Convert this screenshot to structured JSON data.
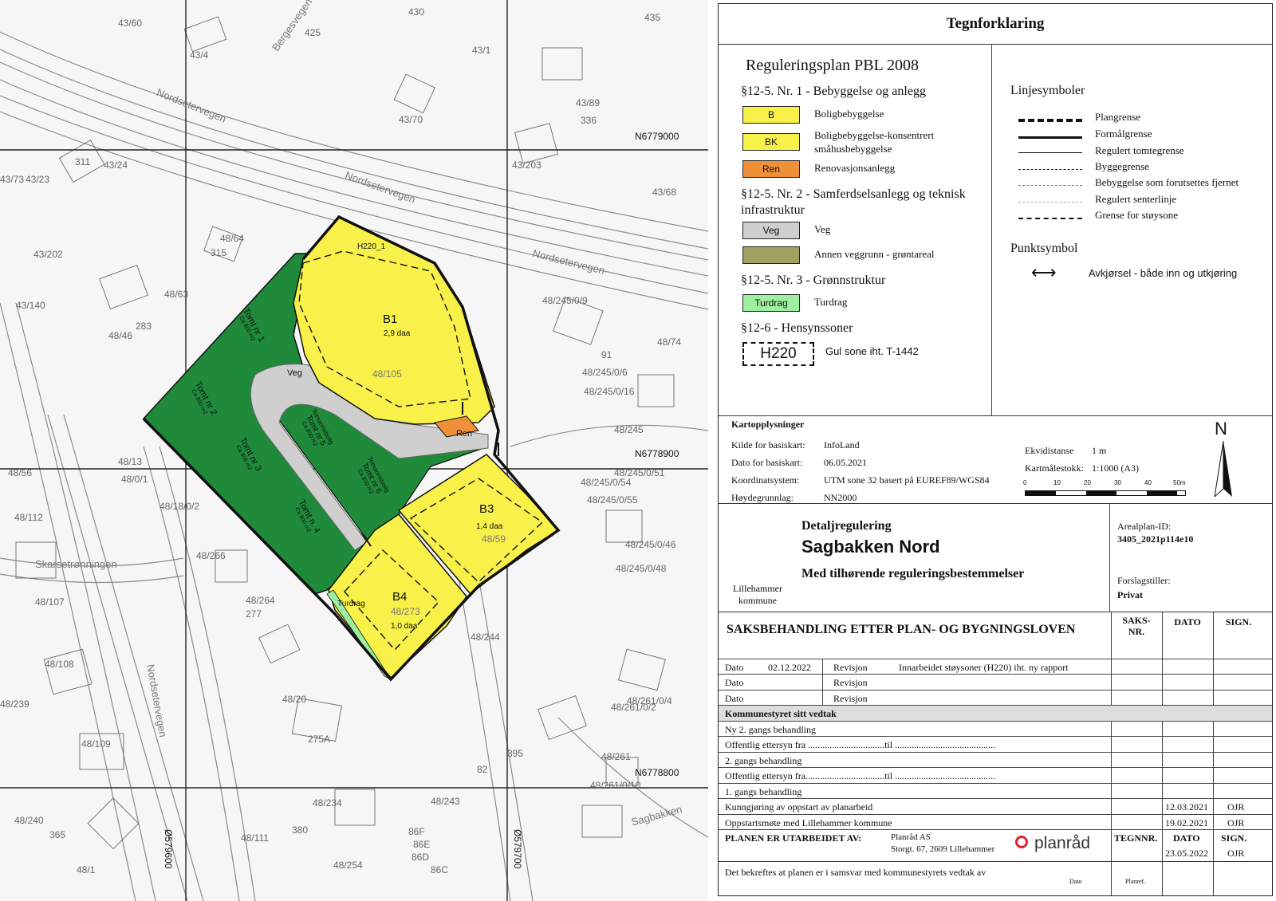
{
  "map": {
    "grid_labels": {
      "n1": "N6779000",
      "n2": "N6778900",
      "n3": "N6778800",
      "e1": "Ø579600",
      "e2": "Ø579700"
    },
    "property_labels": [
      "43/60",
      "43/4",
      "430",
      "425",
      "435",
      "43/1",
      "43/89",
      "336",
      "43/70",
      "43/23",
      "311",
      "43/24",
      "43/203",
      "43/68",
      "43/73",
      "48/64",
      "315",
      "43/202",
      "48/63",
      "43/140",
      "283",
      "48/46",
      "48/74",
      "91",
      "48/245",
      "48/245/0/9",
      "48/245/0/16",
      "48/245/0/6",
      "48/245/0/51",
      "48/245/0/54",
      "48/245/0/55",
      "48/245/0/46",
      "48/245/0/48",
      "48/56",
      "48/112",
      "48/266",
      "48/107",
      "48/264",
      "277",
      "48/244",
      "48/108",
      "48/109",
      "48/239",
      "48/20",
      "275A",
      "48/261",
      "48/261/0/2",
      "48/261/0/4",
      "48/261/0/10",
      "48/243",
      "86F",
      "86E",
      "86D",
      "86C",
      "48/240",
      "365",
      "48/111",
      "380",
      "48/234",
      "48/254",
      "395",
      "48/1",
      "48/13",
      "48/0/1",
      "48/18/0/2",
      "82"
    ],
    "road_labels": [
      "Nordsetervegen",
      "Nordsetervegen",
      "Nordsetervegen",
      "Bergesvegen",
      "Skarsetrønningen",
      "Nordsetervegen",
      "Sagbakken"
    ],
    "zones": {
      "b1": {
        "name": "B1",
        "area": "2,9 daa",
        "parcel": "48/105"
      },
      "b3": {
        "name": "B3",
        "area": "1,4 daa",
        "parcel": "48/59"
      },
      "b4": {
        "name": "B4",
        "area": "1,0 daa",
        "parcel": "48/273"
      },
      "ren": "Ren",
      "veg": "Veg",
      "turdrag": "Turdrag",
      "h220": "H220_1"
    },
    "plots": [
      {
        "name": "Tomt nr 1",
        "size": "Ca 800 m2"
      },
      {
        "name": "Tomt nr 2",
        "size": "Ca 800 m2"
      },
      {
        "name": "Tomt nr 3",
        "size": "Ca 800 m2"
      },
      {
        "name": "Tomt n. 4",
        "size": "Ca 800 m2"
      },
      {
        "name": "Tomt nr 5",
        "sub": "Tomannsbolig",
        "size": "Ca 800 m2"
      },
      {
        "name": "Tomt nr 6",
        "sub": "Tomannsbolig",
        "size": "Ca 800 m2"
      }
    ]
  },
  "legend": {
    "title": "Tegnforklaring",
    "plan_heading": "Reguleringsplan PBL 2008",
    "sec1": "§12-5. Nr. 1 - Bebyggelse og anlegg",
    "sec1_items": [
      {
        "code": "B",
        "label": "Boligbebyggelse",
        "color": "#f7f14a"
      },
      {
        "code": "BK",
        "label": "Boligbebyggelse-konsentrert småhusbebyggelse",
        "color": "#f7f14a"
      },
      {
        "code": "Ren",
        "label": "Renovasjonsanlegg",
        "color": "#f0913a"
      }
    ],
    "sec2": "§12-5. Nr. 2 - Samferdselsanlegg og teknisk infrastruktur",
    "sec2_items": [
      {
        "code": "Veg",
        "label": "Veg",
        "color": "#cfcfcf"
      },
      {
        "code": "",
        "label": "Annen veggrunn - grøntareal",
        "color": "#a3a061"
      }
    ],
    "sec3": "§12-5. Nr. 3 - Grønnstruktur",
    "sec3_items": [
      {
        "code": "Turdrag",
        "label": "Turdrag",
        "color": "#9ef0a0"
      }
    ],
    "sec4": "§12-6 - Hensynssoner",
    "sec4_items": [
      {
        "code": "H220",
        "label": "Gul sone iht. T-1442"
      }
    ],
    "line_heading": "Linjesymboler",
    "lines": [
      "Plangrense",
      "Formålgrense",
      "Regulert tomtegrense",
      "Byggegrense",
      "Bebyggelse som forutsettes fjernet",
      "Regulert senterlinje",
      "Grense for støysone"
    ],
    "point_heading": "Punktsymbol",
    "point_label": "Avkjørsel - både inn og utkjøring"
  },
  "map_info": {
    "heading": "Kartopplysninger",
    "rows": [
      {
        "k": "Kilde for basiskart:",
        "v": "InfoLand"
      },
      {
        "k": "Dato for basiskart:",
        "v": "06.05.2021"
      },
      {
        "k": "Koordinatsystem:",
        "v": "UTM sone 32 basert på EUREF89/WGS84"
      },
      {
        "k": "Høydegrunnlag:",
        "v": "NN2000"
      }
    ],
    "ekvidistanse_label": "Ekvidistanse",
    "ekvidistanse": "1 m",
    "scale_label": "Kartmålestokk:",
    "scale": "1:1000 (A3)",
    "scale_ticks": [
      "0",
      "10",
      "20",
      "30",
      "40",
      "50m"
    ],
    "north": "N"
  },
  "title_block": {
    "type": "Detaljregulering",
    "name": "Sagbakken Nord",
    "sub": "Med tilhørende reguleringsbestemmelser",
    "municipality_line1": "Lillehammer",
    "municipality_line2": "kommune",
    "plan_id_label": "Arealplan-ID:",
    "plan_id": "3405_2021p114e10",
    "proposer_label": "Forslagstiller:",
    "proposer": "Privat"
  },
  "process": {
    "heading": "SAKSBEHANDLING ETTER PLAN- OG BYGNINGSLOVEN",
    "col_saksnr": "SAKS-\nNR.",
    "col_dato": "DATO",
    "col_sign": "SIGN.",
    "revisions": [
      {
        "k": "Dato",
        "d": "02.12.2022",
        "r": "Revisjon",
        "t": "Innarbeidet støysoner (H220) iht. ny rapport"
      },
      {
        "k": "Dato",
        "d": "",
        "r": "Revisjon",
        "t": ""
      },
      {
        "k": "Dato",
        "d": "",
        "r": "Revisjon",
        "t": ""
      }
    ],
    "council": "Kommunestyret sitt vedtak",
    "steps": [
      {
        "t": "Ny 2. gangs behandling",
        "d": "",
        "s": ""
      },
      {
        "t": "Offentlig ettersyn fra ................................til ..........................................",
        "d": "",
        "s": ""
      },
      {
        "t": "2. gangs behandling",
        "d": "",
        "s": ""
      },
      {
        "t": "Offentlig ettersyn fra.................................til ..........................................",
        "d": "",
        "s": ""
      },
      {
        "t": "1. gangs behandling",
        "d": "",
        "s": ""
      },
      {
        "t": "Kunngjøring av oppstart av planarbeid",
        "d": "12.03.2021",
        "s": "OJR"
      },
      {
        "t": "Oppstartsmøte med Lillehammer kommune",
        "d": "19.02.2021",
        "s": "OJR"
      }
    ],
    "prepared_label": "PLANEN ER UTARBEIDET AV:",
    "prepared_name": "Planråd AS",
    "prepared_addr": "Storgt. 67, 2609 Lillehammer",
    "logo_text": "planråd",
    "col_tegnnr": "TEGNNR.",
    "prepared_date": "23.05.2022",
    "prepared_sign": "OJR",
    "confirm": "Det bekreftes at planen er i samsvar med kommunestyrets vedtak av",
    "confirm_dato": "Dato",
    "confirm_plan": "Planref."
  }
}
